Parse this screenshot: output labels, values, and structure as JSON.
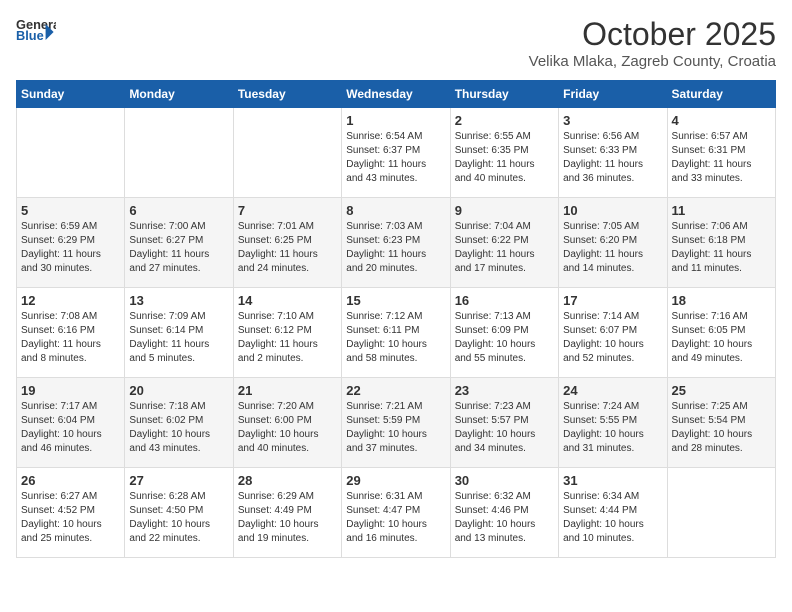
{
  "header": {
    "logo_general": "General",
    "logo_blue": "Blue",
    "month_title": "October 2025",
    "subtitle": "Velika Mlaka, Zagreb County, Croatia"
  },
  "weekdays": [
    "Sunday",
    "Monday",
    "Tuesday",
    "Wednesday",
    "Thursday",
    "Friday",
    "Saturday"
  ],
  "weeks": [
    [
      {
        "num": "",
        "info": ""
      },
      {
        "num": "",
        "info": ""
      },
      {
        "num": "",
        "info": ""
      },
      {
        "num": "1",
        "info": "Sunrise: 6:54 AM\nSunset: 6:37 PM\nDaylight: 11 hours\nand 43 minutes."
      },
      {
        "num": "2",
        "info": "Sunrise: 6:55 AM\nSunset: 6:35 PM\nDaylight: 11 hours\nand 40 minutes."
      },
      {
        "num": "3",
        "info": "Sunrise: 6:56 AM\nSunset: 6:33 PM\nDaylight: 11 hours\nand 36 minutes."
      },
      {
        "num": "4",
        "info": "Sunrise: 6:57 AM\nSunset: 6:31 PM\nDaylight: 11 hours\nand 33 minutes."
      }
    ],
    [
      {
        "num": "5",
        "info": "Sunrise: 6:59 AM\nSunset: 6:29 PM\nDaylight: 11 hours\nand 30 minutes."
      },
      {
        "num": "6",
        "info": "Sunrise: 7:00 AM\nSunset: 6:27 PM\nDaylight: 11 hours\nand 27 minutes."
      },
      {
        "num": "7",
        "info": "Sunrise: 7:01 AM\nSunset: 6:25 PM\nDaylight: 11 hours\nand 24 minutes."
      },
      {
        "num": "8",
        "info": "Sunrise: 7:03 AM\nSunset: 6:23 PM\nDaylight: 11 hours\nand 20 minutes."
      },
      {
        "num": "9",
        "info": "Sunrise: 7:04 AM\nSunset: 6:22 PM\nDaylight: 11 hours\nand 17 minutes."
      },
      {
        "num": "10",
        "info": "Sunrise: 7:05 AM\nSunset: 6:20 PM\nDaylight: 11 hours\nand 14 minutes."
      },
      {
        "num": "11",
        "info": "Sunrise: 7:06 AM\nSunset: 6:18 PM\nDaylight: 11 hours\nand 11 minutes."
      }
    ],
    [
      {
        "num": "12",
        "info": "Sunrise: 7:08 AM\nSunset: 6:16 PM\nDaylight: 11 hours\nand 8 minutes."
      },
      {
        "num": "13",
        "info": "Sunrise: 7:09 AM\nSunset: 6:14 PM\nDaylight: 11 hours\nand 5 minutes."
      },
      {
        "num": "14",
        "info": "Sunrise: 7:10 AM\nSunset: 6:12 PM\nDaylight: 11 hours\nand 2 minutes."
      },
      {
        "num": "15",
        "info": "Sunrise: 7:12 AM\nSunset: 6:11 PM\nDaylight: 10 hours\nand 58 minutes."
      },
      {
        "num": "16",
        "info": "Sunrise: 7:13 AM\nSunset: 6:09 PM\nDaylight: 10 hours\nand 55 minutes."
      },
      {
        "num": "17",
        "info": "Sunrise: 7:14 AM\nSunset: 6:07 PM\nDaylight: 10 hours\nand 52 minutes."
      },
      {
        "num": "18",
        "info": "Sunrise: 7:16 AM\nSunset: 6:05 PM\nDaylight: 10 hours\nand 49 minutes."
      }
    ],
    [
      {
        "num": "19",
        "info": "Sunrise: 7:17 AM\nSunset: 6:04 PM\nDaylight: 10 hours\nand 46 minutes."
      },
      {
        "num": "20",
        "info": "Sunrise: 7:18 AM\nSunset: 6:02 PM\nDaylight: 10 hours\nand 43 minutes."
      },
      {
        "num": "21",
        "info": "Sunrise: 7:20 AM\nSunset: 6:00 PM\nDaylight: 10 hours\nand 40 minutes."
      },
      {
        "num": "22",
        "info": "Sunrise: 7:21 AM\nSunset: 5:59 PM\nDaylight: 10 hours\nand 37 minutes."
      },
      {
        "num": "23",
        "info": "Sunrise: 7:23 AM\nSunset: 5:57 PM\nDaylight: 10 hours\nand 34 minutes."
      },
      {
        "num": "24",
        "info": "Sunrise: 7:24 AM\nSunset: 5:55 PM\nDaylight: 10 hours\nand 31 minutes."
      },
      {
        "num": "25",
        "info": "Sunrise: 7:25 AM\nSunset: 5:54 PM\nDaylight: 10 hours\nand 28 minutes."
      }
    ],
    [
      {
        "num": "26",
        "info": "Sunrise: 6:27 AM\nSunset: 4:52 PM\nDaylight: 10 hours\nand 25 minutes."
      },
      {
        "num": "27",
        "info": "Sunrise: 6:28 AM\nSunset: 4:50 PM\nDaylight: 10 hours\nand 22 minutes."
      },
      {
        "num": "28",
        "info": "Sunrise: 6:29 AM\nSunset: 4:49 PM\nDaylight: 10 hours\nand 19 minutes."
      },
      {
        "num": "29",
        "info": "Sunrise: 6:31 AM\nSunset: 4:47 PM\nDaylight: 10 hours\nand 16 minutes."
      },
      {
        "num": "30",
        "info": "Sunrise: 6:32 AM\nSunset: 4:46 PM\nDaylight: 10 hours\nand 13 minutes."
      },
      {
        "num": "31",
        "info": "Sunrise: 6:34 AM\nSunset: 4:44 PM\nDaylight: 10 hours\nand 10 minutes."
      },
      {
        "num": "",
        "info": ""
      }
    ]
  ]
}
